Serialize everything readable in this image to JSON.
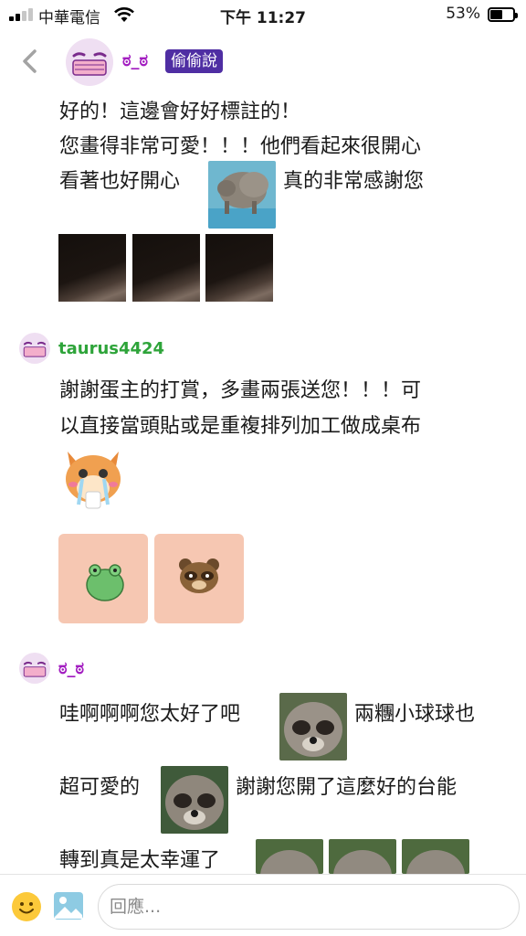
{
  "status_bar": {
    "carrier": "中華電信",
    "time": "下午 11:27",
    "battery": "53%",
    "battery_level": 0.53
  },
  "header": {
    "name": "ಠ_ಠ",
    "badge": "偷偷說"
  },
  "messages": {
    "first": {
      "line1": "好的！這邊會好好標註的！",
      "line2": "您畫得非常可愛！！！他們看起來很開心",
      "line3a": "看著也好開心",
      "line3b": "真的非常感謝您"
    },
    "second": {
      "username": "taurus4424",
      "line1": "謝謝蛋主的打賞，多畫兩張送您！！！可",
      "line2": "以直接當頭貼或是重複排列加工做成桌布"
    },
    "third": {
      "username": "ಠ_ಠ",
      "line1a": "哇啊啊啊您太好了吧",
      "line1b": "兩糰小球球也",
      "line2a": "超可愛的",
      "line2b": "謝謝您開了這麼好的台能",
      "line3a": "轉到真是太幸運了"
    }
  },
  "reply": {
    "placeholder": "回應..."
  },
  "colors": {
    "accent_purple": "#a21cc0",
    "badge": "#4f2ea3",
    "username_green": "#2ea43a",
    "sticker_bg": "#f6c7b2"
  },
  "icons": [
    "back-icon",
    "emoji-icon",
    "image-icon",
    "wifi-icon",
    "signal-icon",
    "battery-icon"
  ]
}
